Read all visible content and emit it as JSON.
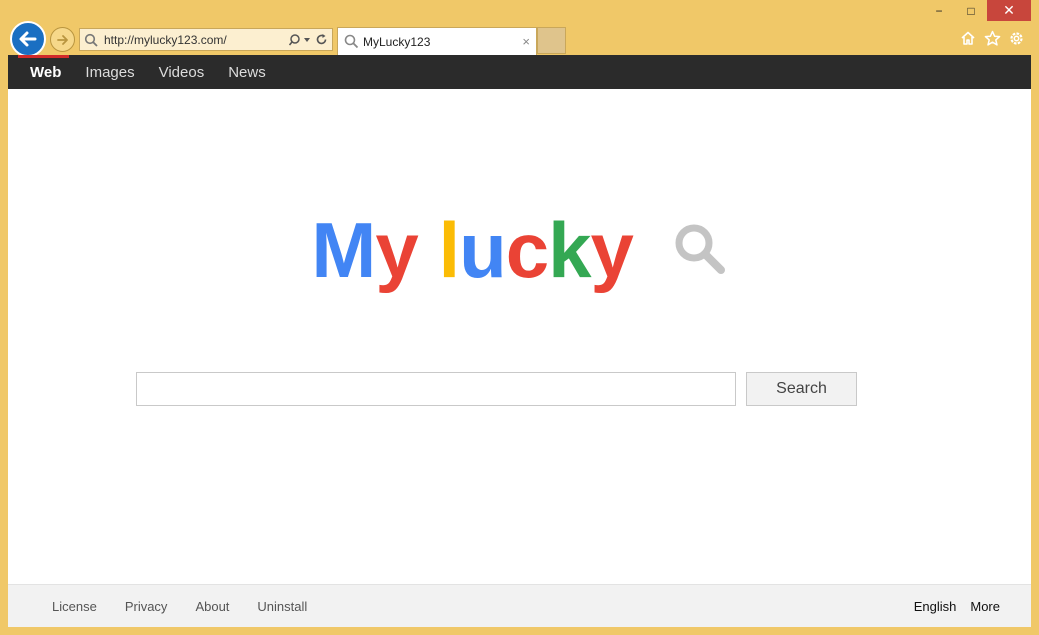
{
  "browser": {
    "address_url": "http://mylucky123.com/",
    "tab_title": "MyLucky123",
    "window_controls": {
      "minimize": "−",
      "maximize": "□",
      "close": "✕"
    },
    "tab_close": "×"
  },
  "nav": {
    "items": [
      {
        "label": "Web",
        "active": true
      },
      {
        "label": "Images",
        "active": false
      },
      {
        "label": "Videos",
        "active": false
      },
      {
        "label": "News",
        "active": false
      }
    ]
  },
  "logo": {
    "letters": [
      {
        "char": "M",
        "color": "#4285f4"
      },
      {
        "char": "y",
        "color": "#ea4335"
      },
      {
        "char": " ",
        "color": "#ffffff"
      },
      {
        "char": "l",
        "color": "#fbbc05"
      },
      {
        "char": "u",
        "color": "#4285f4"
      },
      {
        "char": "c",
        "color": "#ea4335"
      },
      {
        "char": "k",
        "color": "#34a853"
      },
      {
        "char": "y",
        "color": "#ea4335"
      }
    ],
    "icon": "magnifier-icon",
    "icon_color": "#c4c4c4"
  },
  "search": {
    "input_value": "",
    "button_label": "Search"
  },
  "footer": {
    "left_links": [
      "License",
      "Privacy",
      "About",
      "Uninstall"
    ],
    "right_links": [
      "English",
      "More"
    ]
  },
  "colors": {
    "frame": "#f0c868",
    "nav_bg": "#2b2b2b",
    "nav_active_accent": "#d12a2a",
    "close_button": "#c8463c",
    "back_button": "#1a6fc2"
  }
}
